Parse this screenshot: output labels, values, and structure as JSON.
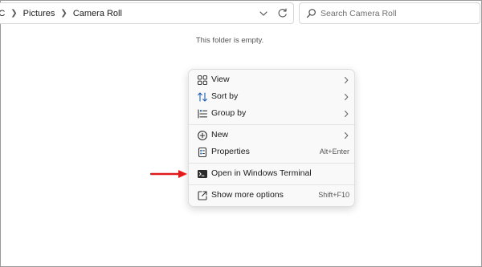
{
  "address_bar": {
    "breadcrumbs": [
      "PC",
      "Pictures",
      "Camera Roll"
    ]
  },
  "search": {
    "placeholder": "Search Camera Roll"
  },
  "content": {
    "empty_message": "This folder is empty."
  },
  "context_menu": {
    "items": [
      {
        "label": "View",
        "icon": "grid-view-icon",
        "submenu": true
      },
      {
        "label": "Sort by",
        "icon": "sort-arrows-icon",
        "submenu": true
      },
      {
        "label": "Group by",
        "icon": "group-list-icon",
        "submenu": true
      },
      {
        "label": "New",
        "icon": "plus-circle-icon",
        "submenu": true
      },
      {
        "label": "Properties",
        "icon": "properties-icon",
        "shortcut": "Alt+Enter"
      },
      {
        "label": "Open in Windows Terminal",
        "icon": "terminal-icon"
      },
      {
        "label": "Show more options",
        "icon": "external-open-icon",
        "shortcut": "Shift+F10"
      }
    ]
  },
  "annotation": {
    "arrow_color": "#e01a1a"
  },
  "colors": {
    "accent": "#1a5fb4",
    "menu_background": "#f9f9f9"
  }
}
